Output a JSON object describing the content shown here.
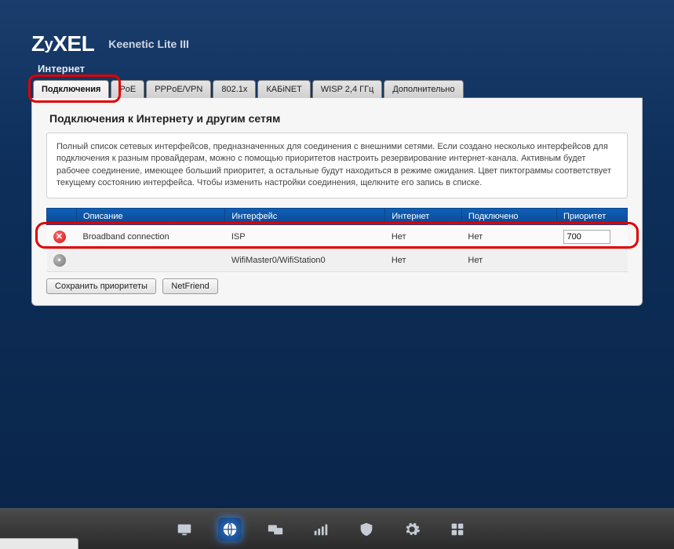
{
  "brand": "ZyXEL",
  "product": "Keenetic Lite III",
  "section": "Интернет",
  "tabs": [
    {
      "label": "Подключения",
      "active": true
    },
    {
      "label": "PoE",
      "active": false
    },
    {
      "label": "PPPoE/VPN",
      "active": false
    },
    {
      "label": "802.1x",
      "active": false
    },
    {
      "label": "КАБiNET",
      "active": false
    },
    {
      "label": "WISP 2,4 ГГц",
      "active": false
    },
    {
      "label": "Дополнительно",
      "active": false
    }
  ],
  "panel": {
    "title": "Подключения к Интернету и другим сетям",
    "description": "Полный список сетевых интерфейсов, предназначенных для соединения с внешними сетями. Если создано несколько интерфейсов для подключения к разным провайдерам, можно с помощью приоритетов настроить резервирование интернет-канала. Активным будет рабочее соединение, имеющее больший приоритет, а остальные будут находиться в режиме ожидания. Цвет пиктограммы соответствует текущему состоянию интерфейса. Чтобы изменить настройки соединения, щелкните его запись в списке."
  },
  "table": {
    "headers": [
      "",
      "Описание",
      "Интерфейс",
      "Интернет",
      "Подключено",
      "Приоритет"
    ],
    "rows": [
      {
        "status": "error",
        "desc": "Broadband connection",
        "iface": "ISP",
        "inet": "Нет",
        "conn": "Нет",
        "prio": "700",
        "editable_prio": true
      },
      {
        "status": "neutral",
        "desc": "",
        "iface": "WifiMaster0/WifiStation0",
        "inet": "Нет",
        "conn": "Нет",
        "prio": "",
        "editable_prio": false
      }
    ]
  },
  "buttons": {
    "save": "Сохранить приоритеты",
    "netfriend": "NetFriend"
  },
  "taskbar_icons": [
    "monitor-icon",
    "globe-icon",
    "screens-icon",
    "signal-icon",
    "shield-icon",
    "gear-icon",
    "apps-icon"
  ]
}
